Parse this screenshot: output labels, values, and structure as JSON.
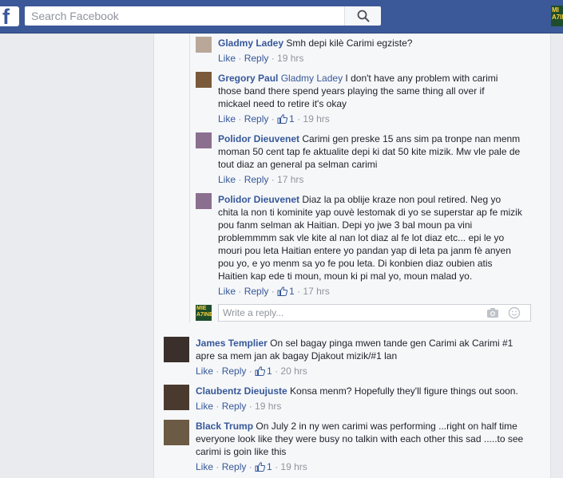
{
  "topbar": {
    "logo": "f",
    "search_placeholder": "Search Facebook",
    "brand_thumb": "MI A7IN"
  },
  "replies": [
    {
      "author": "Gladmy Ladey",
      "mention": "",
      "text": "Smh depi kilè Carimi egziste?",
      "like": "Like",
      "reply": "Reply",
      "like_count": "",
      "time": "19 hrs",
      "avatar_color": "#b9a89a"
    },
    {
      "author": "Gregory Paul",
      "mention": "Gladmy Ladey",
      "text": "I don't have any problem with carimi those band there spend years playing the same thing all over if mickael need to retire it's okay",
      "like": "Like",
      "reply": "Reply",
      "like_count": "1",
      "time": "19 hrs",
      "avatar_color": "#7a5a3a"
    },
    {
      "author": "Polidor Dieuvenet",
      "mention": "",
      "text": "Carimi gen preske 15 ans sim pa tronpe nan menm moman 50 cent tap fe aktualite depi ki dat 50 kite mizik. Mw vle pale de tout diaz an general pa selman carimi",
      "like": "Like",
      "reply": "Reply",
      "like_count": "",
      "time": "17 hrs",
      "avatar_color": "#8a6f8f"
    },
    {
      "author": "Polidor Dieuvenet",
      "mention": "",
      "text": "Diaz la pa oblije kraze non poul retired. Neg yo chita la non ti kominite yap ouvè lestomak di yo se superstar ap fe mizik pou fanm selman ak Haitian. Depi yo jwe 3 bal moun pa vini problemmmm sak vle kite al nan lot diaz al fe lot diaz etc... epi le yo mouri pou leta Haitian entere yo pandan yap di leta pa janm fè anyen pou yo, e yo menm sa yo fe pou leta. Di konbien diaz oubien atis Haitien kap ede ti moun, moun ki pi mal yo, moun malad yo.",
      "like": "Like",
      "reply": "Reply",
      "like_count": "1",
      "time": "17 hrs",
      "avatar_color": "#8a6f8f"
    }
  ],
  "write_reply": {
    "placeholder": "Write a reply...",
    "avatar_text": "MIE A7INE"
  },
  "comments": [
    {
      "author": "James Templier",
      "text": "On sel bagay pinga mwen tande gen Carimi ak Carimi #1 apre sa mem jan ak bagay Djakout mizik/#1 lan",
      "like": "Like",
      "reply": "Reply",
      "like_count": "1",
      "time": "20 hrs",
      "avatar_color": "#3a2f2a"
    },
    {
      "author": "Claubentz Dieujuste",
      "text": "Konsa menm? Hopefully they'll figure things out soon.",
      "like": "Like",
      "reply": "Reply",
      "like_count": "",
      "time": "19 hrs",
      "avatar_color": "#4a3a2e"
    },
    {
      "author": "Black Trump",
      "text": "On July 2 in ny wen carimi was performing ...right on half time everyone look like they were busy no talkin with each other this sad .....to see carimi is goin like this",
      "like": "Like",
      "reply": "Reply",
      "like_count": "1",
      "time": "19 hrs",
      "avatar_color": "#6b5a44"
    }
  ],
  "colors": {
    "topbar": "#3b5998",
    "link": "#365899",
    "meta": "#90949c",
    "background": "#e9ebee"
  },
  "icons": [
    "facebook-logo",
    "search-icon",
    "like-thumb-icon",
    "camera-icon",
    "emoji-icon"
  ]
}
